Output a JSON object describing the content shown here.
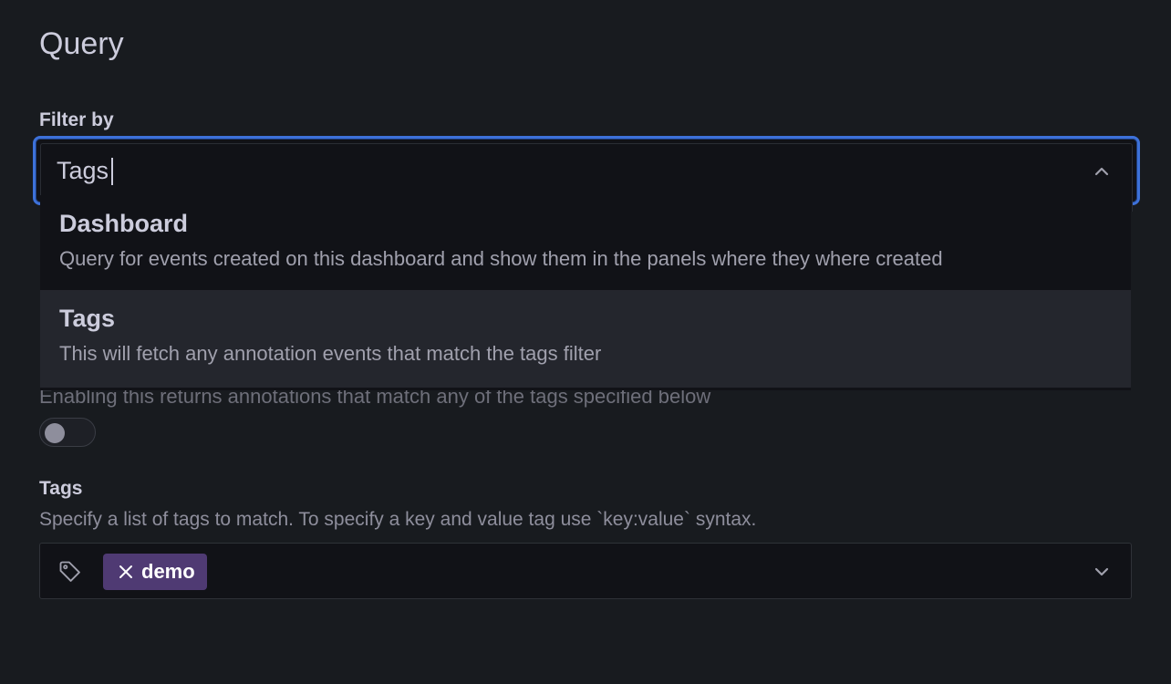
{
  "section": {
    "title": "Query"
  },
  "filter": {
    "label": "Filter by",
    "value": "Tags",
    "options": [
      {
        "title": "Dashboard",
        "description": "Query for events created on this dashboard and show them in the panels where they where created"
      },
      {
        "title": "Tags",
        "description": "This will fetch any annotation events that match the tags filter"
      }
    ]
  },
  "match_any": {
    "description": "Enabling this returns annotations that match any of the tags specified below",
    "enabled": false
  },
  "tags": {
    "label": "Tags",
    "description": "Specify a list of tags to match. To specify a key and value tag use `key:value` syntax.",
    "items": [
      "demo"
    ]
  },
  "colors": {
    "focus_border": "#3d71d9",
    "tag_chip": "#4f3a73",
    "background": "#181b1f"
  }
}
